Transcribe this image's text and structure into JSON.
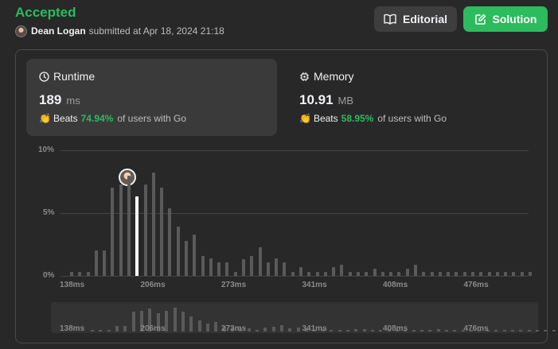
{
  "header": {
    "status": "Accepted",
    "user": "Dean Logan",
    "submitted_text": "submitted at Apr 18, 2024 21:18",
    "editorial_label": "Editorial",
    "solution_label": "Solution"
  },
  "runtime": {
    "title": "Runtime",
    "value": "189",
    "unit": "ms",
    "beats_word": "Beats",
    "beats_pct": "74.94%",
    "suffix": "of users with Go"
  },
  "memory": {
    "title": "Memory",
    "value": "10.91",
    "unit": "MB",
    "beats_word": "Beats",
    "beats_pct": "58.95%",
    "suffix": "of users with Go"
  },
  "chart_data": {
    "type": "bar",
    "title": "",
    "xlabel": "",
    "ylabel": "",
    "ylim": [
      0,
      10
    ],
    "y_ticks": [
      "10%",
      "5%",
      "0%"
    ],
    "x_ticks": [
      "138ms",
      "206ms",
      "273ms",
      "341ms",
      "408ms",
      "476ms"
    ],
    "highlight_index": 8,
    "values": [
      0.3,
      0.3,
      0.3,
      2.0,
      2.0,
      7.0,
      7.3,
      8.0,
      6.3,
      7.3,
      8.2,
      7.0,
      5.4,
      3.9,
      2.8,
      3.3,
      1.6,
      1.4,
      1.1,
      1.1,
      0.3,
      1.3,
      1.6,
      2.3,
      1.1,
      1.4,
      1.1,
      0.3,
      0.7,
      0.3,
      0.3,
      0.3,
      0.7,
      0.9,
      0.3,
      0.3,
      0.3,
      0.6,
      0.3,
      0.3,
      0.3,
      0.6,
      0.9,
      0.3,
      0.3,
      0.3,
      0.3,
      0.3,
      0.3,
      0.3,
      0.3,
      0.3,
      0.3,
      0.3,
      0.3,
      0.3,
      0.3
    ]
  },
  "mini_chart": {
    "x_ticks": [
      "138ms",
      "206ms",
      "273ms",
      "341ms",
      "408ms",
      "476ms"
    ]
  }
}
